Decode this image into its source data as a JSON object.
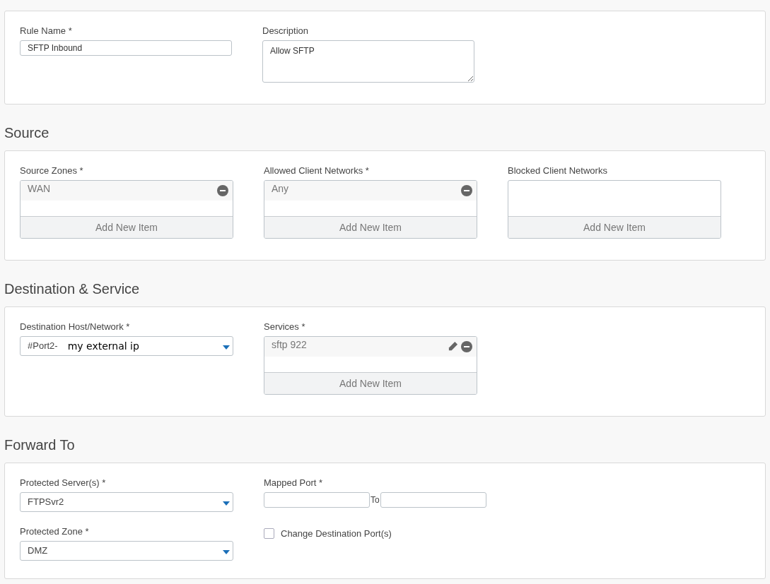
{
  "general": {
    "rule_name": {
      "label": "Rule Name *",
      "value": "SFTP Inbound"
    },
    "description": {
      "label": "Description",
      "value": "Allow SFTP"
    }
  },
  "source": {
    "title": "Source",
    "lists": [
      {
        "label": "Source Zones *",
        "items": [
          {
            "text": "WAN",
            "editable": false
          }
        ],
        "add_label": "Add New Item"
      },
      {
        "label": "Allowed Client Networks *",
        "items": [
          {
            "text": "Any",
            "editable": false
          }
        ],
        "add_label": "Add New Item"
      },
      {
        "label": "Blocked Client Networks",
        "add_label": "Add New Item"
      }
    ]
  },
  "destination": {
    "title": "Destination & Service",
    "host": {
      "label": "Destination Host/Network *",
      "prefix": "#Port2-",
      "value": "my external ip"
    },
    "services": {
      "label": "Services *",
      "items": [
        {
          "text": "sftp 922",
          "editable": true
        }
      ],
      "add_label": "Add New Item"
    }
  },
  "forward": {
    "title": "Forward To",
    "server": {
      "label": "Protected Server(s) *",
      "value": "FTPSvr2"
    },
    "zone": {
      "label": "Protected Zone *",
      "value": "DMZ"
    },
    "mapped_port": {
      "label": "Mapped Port *",
      "to_label": "To"
    },
    "change_port": {
      "label": "Change Destination Port(s)",
      "checked": false
    }
  }
}
